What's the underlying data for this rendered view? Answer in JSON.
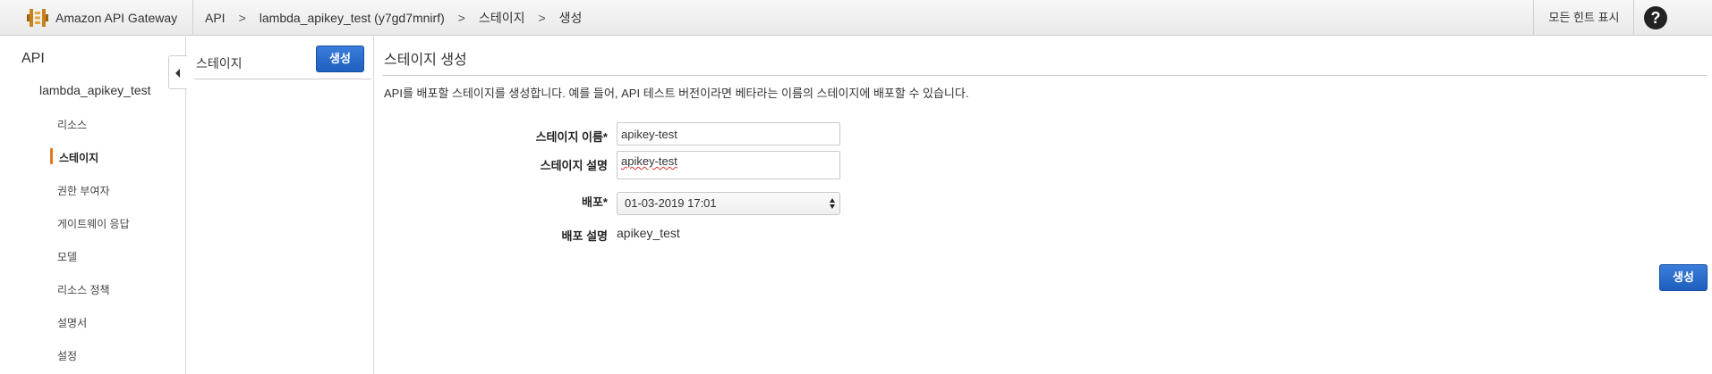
{
  "header": {
    "brand": "Amazon API Gateway",
    "breadcrumbs": [
      "API",
      "lambda_apikey_test (y7gd7mnirf)",
      "스테이지",
      "생성"
    ],
    "separator": ">",
    "hints_label": "모든 힌트 표시",
    "help_label": "?"
  },
  "sidebar": {
    "api_label": "API",
    "api_name": "lambda_apikey_test",
    "items": [
      {
        "label": "리소스",
        "active": false
      },
      {
        "label": "스테이지",
        "active": true
      },
      {
        "label": "권한 부여자",
        "active": false
      },
      {
        "label": "게이트웨이 응답",
        "active": false
      },
      {
        "label": "모델",
        "active": false
      },
      {
        "label": "리소스 정책",
        "active": false
      },
      {
        "label": "설명서",
        "active": false
      },
      {
        "label": "설정",
        "active": false
      }
    ]
  },
  "stage_list": {
    "title": "스테이지",
    "create_label": "생성"
  },
  "main": {
    "title": "스테이지 생성",
    "description": "API를 배포할 스테이지를 생성합니다. 예를 들어, API 테스트 버전이라면 베타라는 이름의 스테이지에 배포할 수 있습니다.",
    "form": {
      "stage_name_label": "스테이지 이름*",
      "stage_name_value": "apikey-test",
      "stage_desc_label": "스테이지 설명",
      "stage_desc_value": "apikey-test",
      "deployment_label": "배포*",
      "deployment_value": "01-03-2019 17:01",
      "deployment_desc_label": "배포 설명",
      "deployment_desc_value": "apikey_test"
    },
    "create_label": "생성"
  },
  "colors": {
    "accent": "#e07b20",
    "button_blue": "#1f5fbf"
  }
}
